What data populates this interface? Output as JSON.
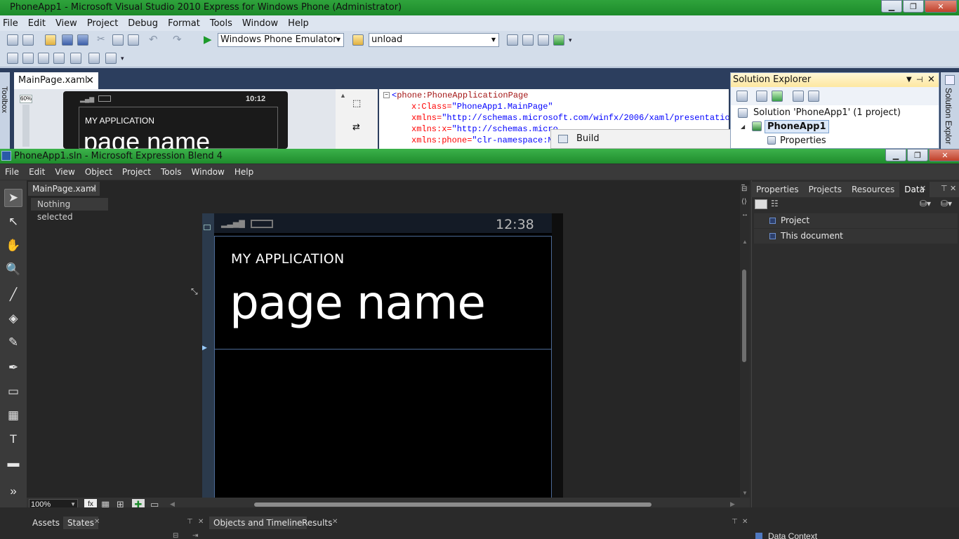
{
  "vs": {
    "title": "PhoneApp1 - Microsoft Visual Studio 2010 Express for Windows Phone (Administrator)",
    "menu": [
      "File",
      "Edit",
      "View",
      "Project",
      "Debug",
      "Format",
      "Tools",
      "Window",
      "Help"
    ],
    "target_combo": "Windows Phone Emulator",
    "find_combo": "unload",
    "doc_tab": "MainPage.xaml",
    "zoom": "60%",
    "designer_phone": {
      "time": "10:12",
      "app_name": "MY APPLICATION",
      "page_name": "page name"
    },
    "code": [
      {
        "prefix": "<",
        "tag": "phone:PhoneApplicationPage",
        "attr": "",
        "value": ""
      },
      {
        "prefix": "",
        "tag": "",
        "attr": "x:Class=",
        "value": "\"PhoneApp1.MainPage\""
      },
      {
        "prefix": "",
        "tag": "",
        "attr": "xmlns=",
        "value": "\"http://schemas.microsoft.com/winfx/2006/xaml/presentation\""
      },
      {
        "prefix": "",
        "tag": "",
        "attr": "xmlns:x=",
        "value": "\"http://schemas.micro"
      },
      {
        "prefix": "",
        "tag": "",
        "attr": "xmlns:phone=",
        "value": "\"clr-namespace:Mi"
      }
    ],
    "solution_explorer": {
      "title": "Solution Explorer",
      "solution": "Solution 'PhoneApp1' (1 project)",
      "project": "PhoneApp1",
      "properties": "Properties"
    },
    "context_menu": {
      "item": "Build"
    },
    "toolbox_label": "Toolbox",
    "right_strip_label": "Solution Explor"
  },
  "blend": {
    "title": "PhoneApp1.sln - Microsoft Expression Blend 4",
    "menu": [
      "File",
      "Edit",
      "View",
      "Object",
      "Project",
      "Tools",
      "Window",
      "Help"
    ],
    "doc_tab": "MainPage.xaml",
    "selection_status": "Nothing selected",
    "phone": {
      "time": "12:38",
      "app_name": "MY APPLICATION",
      "page_name": "page name"
    },
    "zoom": "100%",
    "panel_tabs": [
      "Properties",
      "Projects",
      "Resources",
      "Data"
    ],
    "data_items": [
      "Project",
      "This document"
    ],
    "bottom_left_tabs": [
      "Assets",
      "States"
    ],
    "bottom_mid_tabs": [
      "Objects and Timeline",
      "Results"
    ],
    "data_context": "Data Context"
  }
}
